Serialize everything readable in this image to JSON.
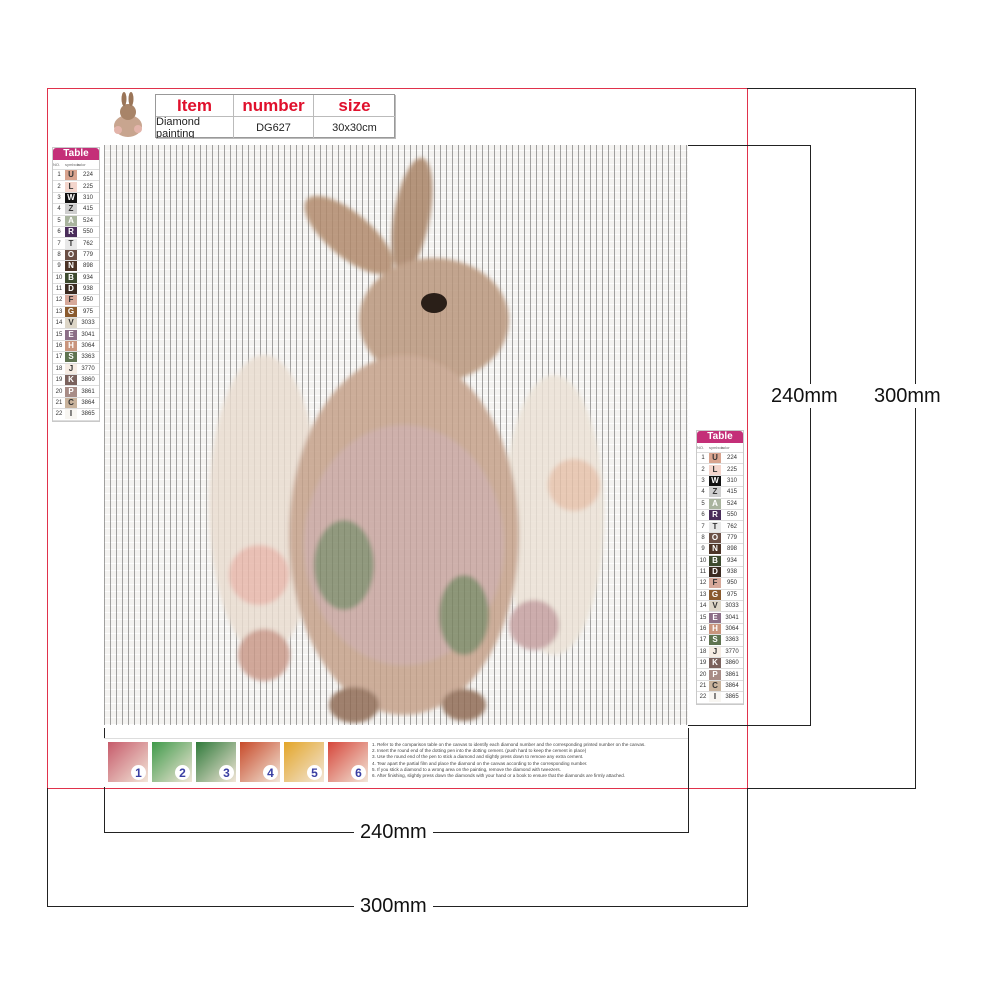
{
  "header": {
    "item_label": "Item",
    "number_label": "number",
    "size_label": "size",
    "item_value": "Diamond painting",
    "number_value": "DG627",
    "size_value": "30x30cm"
  },
  "dimensions": {
    "inner_width": "240mm",
    "outer_width": "300mm",
    "inner_height": "240mm",
    "outer_height": "300mm"
  },
  "table": {
    "title": "Table",
    "col_no": "NO.",
    "col_symbol": "symbols",
    "col_color": "color",
    "rows": [
      {
        "no": "1",
        "sym": "U",
        "code": "224",
        "color": "#d9a48f"
      },
      {
        "no": "2",
        "sym": "L",
        "code": "225",
        "color": "#f3d5cc"
      },
      {
        "no": "3",
        "sym": "W",
        "code": "310",
        "color": "#111111"
      },
      {
        "no": "4",
        "sym": "Z",
        "code": "415",
        "color": "#cfcfcf"
      },
      {
        "no": "5",
        "sym": "A",
        "code": "524",
        "color": "#a9b49e"
      },
      {
        "no": "6",
        "sym": "R",
        "code": "550",
        "color": "#4a2d5a"
      },
      {
        "no": "7",
        "sym": "T",
        "code": "762",
        "color": "#e8e8e8"
      },
      {
        "no": "8",
        "sym": "O",
        "code": "779",
        "color": "#6a4f45"
      },
      {
        "no": "9",
        "sym": "N",
        "code": "898",
        "color": "#4b3326"
      },
      {
        "no": "10",
        "sym": "B",
        "code": "934",
        "color": "#3d4a2e"
      },
      {
        "no": "11",
        "sym": "D",
        "code": "938",
        "color": "#3a2a20"
      },
      {
        "no": "12",
        "sym": "F",
        "code": "950",
        "color": "#d7a99a"
      },
      {
        "no": "13",
        "sym": "G",
        "code": "975",
        "color": "#8a5a2d"
      },
      {
        "no": "14",
        "sym": "V",
        "code": "3033",
        "color": "#ddd6c7"
      },
      {
        "no": "15",
        "sym": "E",
        "code": "3041",
        "color": "#8c6f86"
      },
      {
        "no": "16",
        "sym": "H",
        "code": "3064",
        "color": "#c9957d"
      },
      {
        "no": "17",
        "sym": "S",
        "code": "3363",
        "color": "#5f7350"
      },
      {
        "no": "18",
        "sym": "J",
        "code": "3770",
        "color": "#f6ece3"
      },
      {
        "no": "19",
        "sym": "K",
        "code": "3860",
        "color": "#7b625d"
      },
      {
        "no": "20",
        "sym": "P",
        "code": "3861",
        "color": "#a88c86"
      },
      {
        "no": "21",
        "sym": "C",
        "code": "3864",
        "color": "#c9b39c"
      },
      {
        "no": "22",
        "sym": "I",
        "code": "3865",
        "color": "#f8f6f2"
      }
    ]
  },
  "steps": [
    {
      "num": "1",
      "color": "#c65a6a"
    },
    {
      "num": "2",
      "color": "#3f9a4a"
    },
    {
      "num": "3",
      "color": "#2f7a3a"
    },
    {
      "num": "4",
      "color": "#c74a2a"
    },
    {
      "num": "5",
      "color": "#e3a528"
    },
    {
      "num": "6",
      "color": "#d6463a"
    }
  ],
  "instructions": [
    "1. Refer to the comparison table on the canvas to identify each diamond number and the corresponding printed number on the canvas.",
    "2. Insert the round end of the dotting pen into the dotting cement. (push hard to keep the cement in place)",
    "3. Use the round end of the pen to stick a diamond and slightly press down to remove any extra cement.",
    "4. Tear apart the partial film and place the diamond on the canvas according to the corresponding number.",
    "5. If you stick a diamond to a wrong area on the painting, remove the diamond with tweezers.",
    "6. After finishing, slightly press down the diamonds with your hand or a book to ensure that the diamonds are firmly attached."
  ]
}
